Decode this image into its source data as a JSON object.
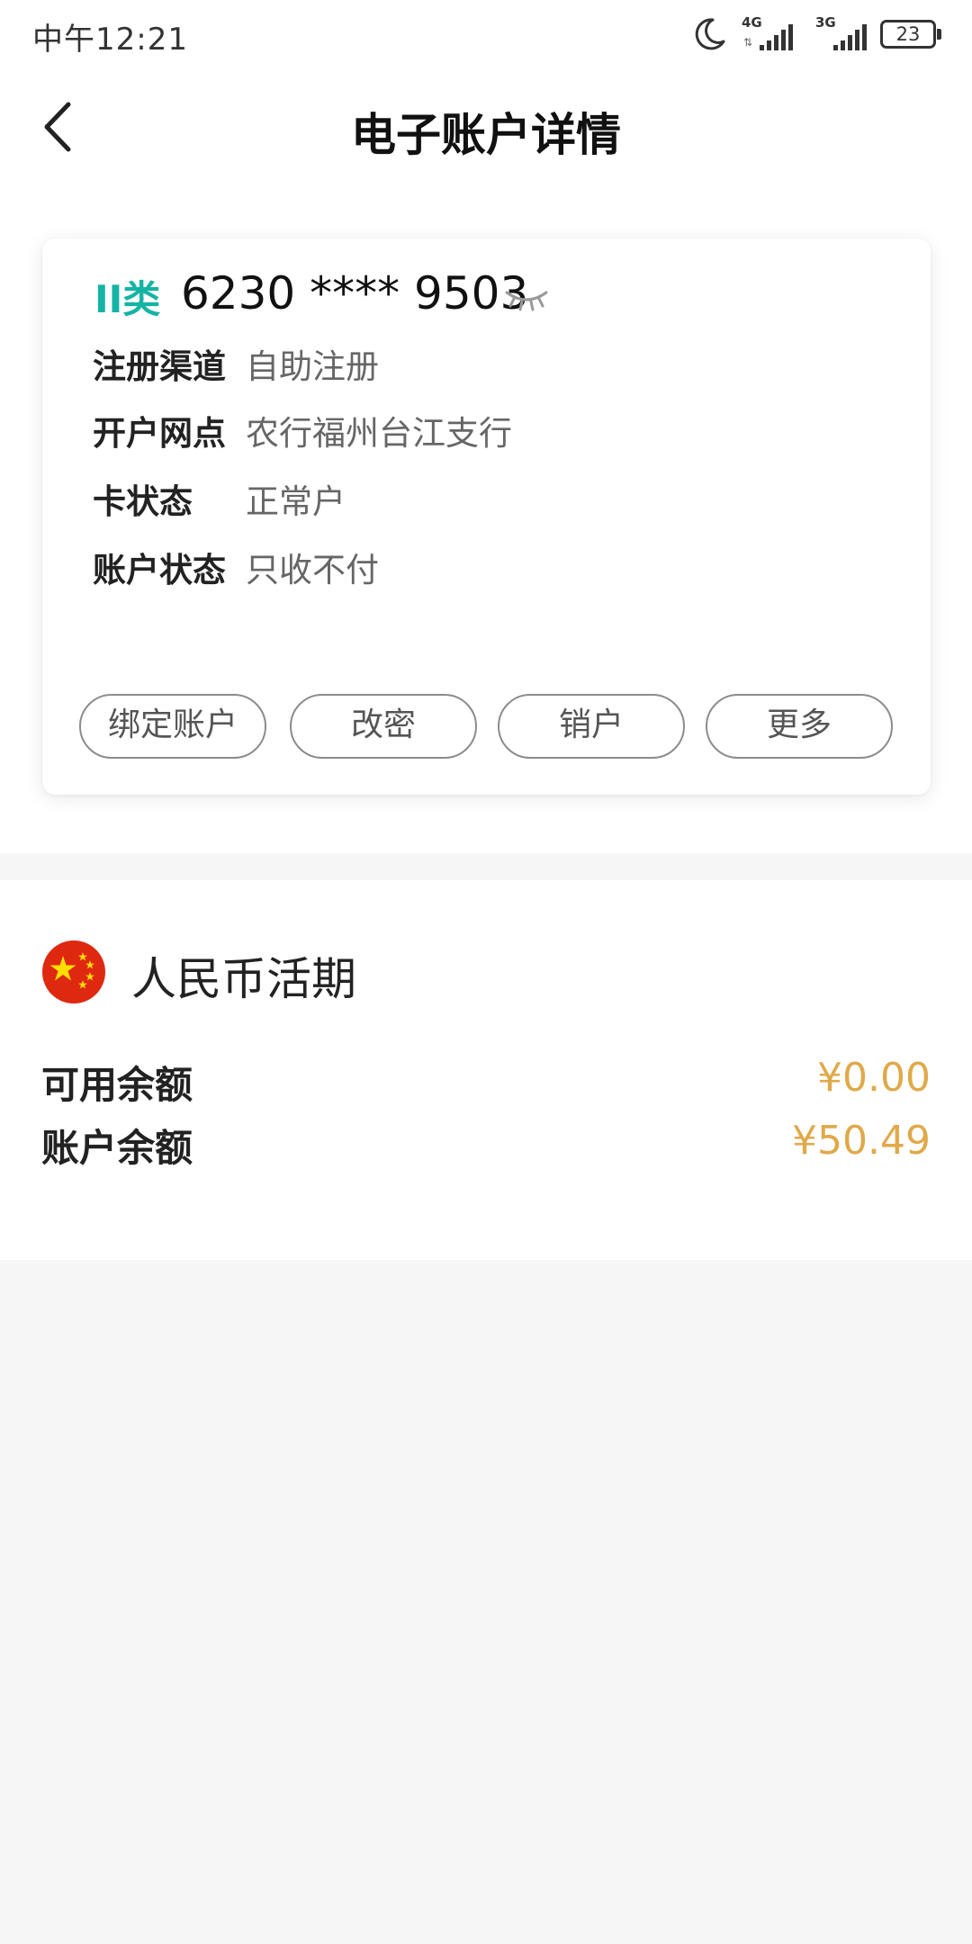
{
  "status_bar": {
    "time": "中午12:21",
    "network1": "4G",
    "network2": "3G",
    "battery": "23",
    "icons": [
      "moon-icon",
      "signal-icon",
      "signal-icon",
      "battery-icon"
    ]
  },
  "nav": {
    "back_icon": "chevron-left-icon",
    "title": "电子账户详情"
  },
  "card": {
    "type": "II类",
    "number": "6230 **** 9503",
    "visibility_icon": "eye-closed-icon",
    "info": [
      {
        "label": "注册渠道",
        "value": "自助注册"
      },
      {
        "label": "开户网点",
        "value": "农行福州台江支行"
      },
      {
        "label": "卡状态",
        "value": "正常户"
      },
      {
        "label": "账户状态",
        "value": "只收不付"
      }
    ],
    "actions": [
      "绑定账户",
      "改密",
      "销户",
      "更多"
    ]
  },
  "balance": {
    "flag_icon": "china-flag-icon",
    "currency": "人民币活期",
    "rows": [
      {
        "label": "可用余额",
        "value": "¥0.00"
      },
      {
        "label": "账户余额",
        "value": "¥50.49"
      }
    ]
  },
  "colors": {
    "accent_teal": "#14b4a5",
    "amount_gold": "#e0a94a",
    "background": "#f6f6f6"
  }
}
